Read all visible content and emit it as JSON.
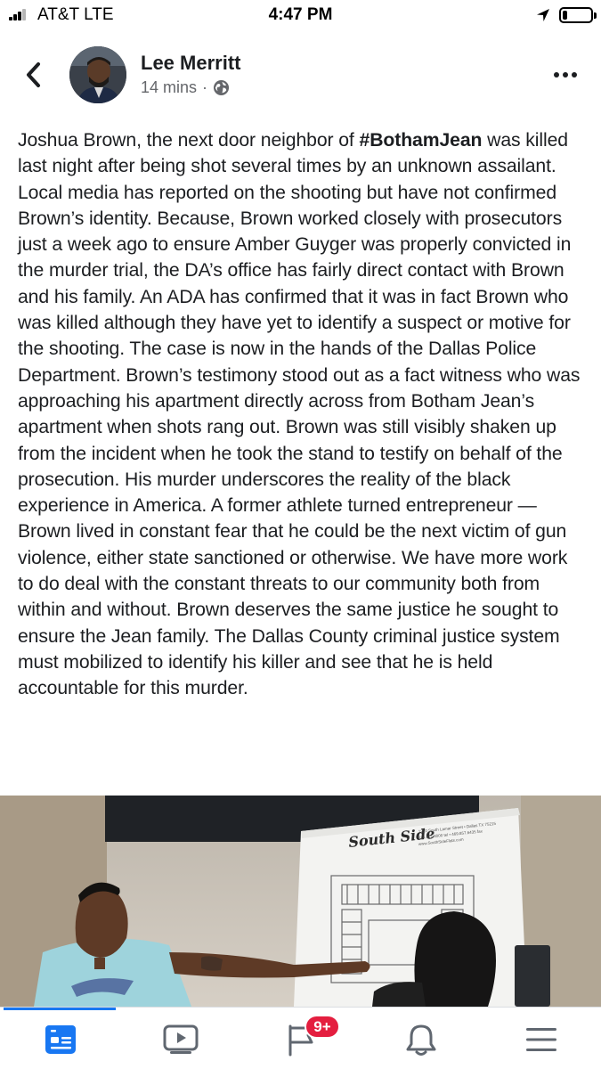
{
  "status_bar": {
    "carrier": "AT&T LTE",
    "time": "4:47 PM",
    "battery_level": 0.18
  },
  "post": {
    "author": "Lee Merritt",
    "time_ago": "14 mins",
    "separator": "·",
    "privacy_icon": "globe-icon",
    "text_before_hashtag": "Joshua Brown, the next door neighbor of ",
    "hashtag": "#BothamJean",
    "text_after_hashtag": " was killed last night after being shot several times by an unknown assailant. Local media has reported on the shooting but have not confirmed Brown’s identity. Because, Brown worked closely with prosecutors just a week ago to ensure Amber Guyger was properly convicted in the murder trial, the DA’s office has fairly direct contact with Brown and his family. An ADA has confirmed that it was in fact Brown who was killed although they have yet to identify a suspect or motive for the shooting. The case is now in the hands of the Dallas Police Department. Brown’s testimony stood out as a fact witness who was approaching his apartment directly across from Botham Jean’s apartment when shots rang out. Brown was still visibly shaken up from the incident when he took the stand to testify on behalf of the prosecution. His murder underscores the reality of the black experience in America. A former athlete turned entrepreneur — Brown lived in constant fear that he could be the next victim of gun violence, either state sanctioned or otherwise. We have more work to do deal with the constant threats to our community both from within and without. Brown deserves the same justice he sought to ensure the Jean family. The Dallas County criminal justice system must mobilized to identify his killer and see that he is held accountable for this murder."
  },
  "photo": {
    "sign_logo": "South Side",
    "sign_address": "1210 South Lamar Street • Dallas TX 75215",
    "sign_phone": "214.421.8000 tel • 469.857.6435 fax",
    "sign_web": "www.SouthSideFlats.com"
  },
  "tab_bar": {
    "tabs": [
      {
        "icon": "news-feed-icon",
        "active": true
      },
      {
        "icon": "watch-video-icon",
        "active": false
      },
      {
        "icon": "pages-flag-icon",
        "active": false
      },
      {
        "icon": "notifications-bell-icon",
        "active": false
      },
      {
        "icon": "menu-icon",
        "active": false
      }
    ],
    "badge": "9+"
  },
  "colors": {
    "accent": "#1877f2",
    "badge": "#e41e3f",
    "text": "#1c1e21",
    "secondary_text": "#65676b",
    "inactive_icon": "#606770"
  }
}
